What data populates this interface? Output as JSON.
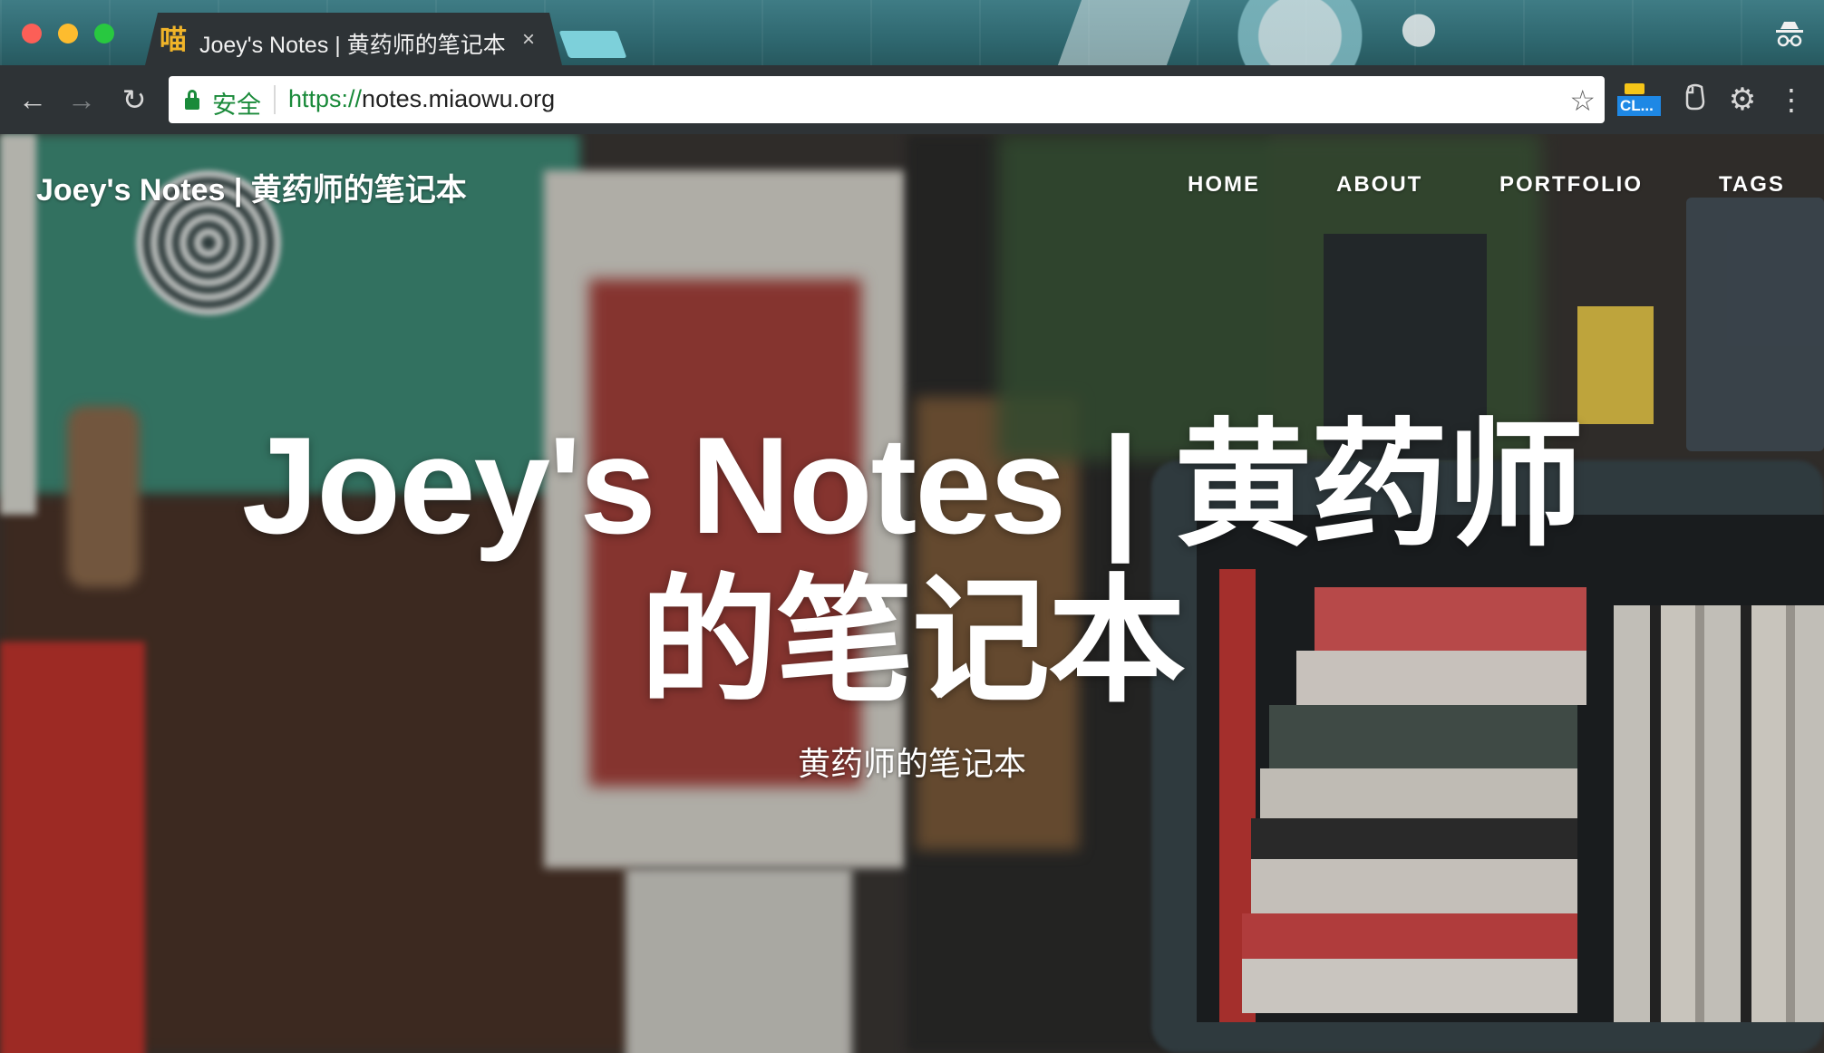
{
  "browser": {
    "tab": {
      "favicon_glyph": "喵",
      "title": "Joey's Notes | 黄药师的笔记本",
      "close_glyph": "×"
    },
    "toolbar": {
      "back_glyph": "←",
      "forward_glyph": "→",
      "reload_glyph": "↻",
      "secure_label": "安全",
      "url_scheme": "https://",
      "url_host": "notes.miaowu.org",
      "bookmark_glyph": "☆",
      "extension_label": "CL...",
      "menu_glyph": "⋮"
    }
  },
  "site": {
    "title": "Joey's Notes | 黄药师的笔记本",
    "nav": [
      "HOME",
      "ABOUT",
      "PORTFOLIO",
      "TAGS"
    ],
    "hero": {
      "heading_line1": "Joey's Notes | 黄药师",
      "heading_line2": "的笔记本",
      "subheading": "黄药师的笔记本"
    }
  },
  "colors": {
    "tabstrip": "#3f7c85",
    "toolbar": "#2e3336",
    "secure_green": "#1a8a3a",
    "nav_text": "#ffffff"
  }
}
